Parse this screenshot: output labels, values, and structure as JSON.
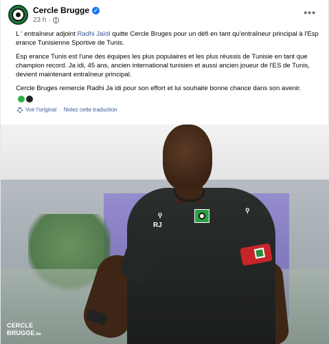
{
  "post": {
    "page_name": "Cercle Brugge",
    "time": "23 h",
    "more_label": "•••",
    "paragraphs": {
      "p1_before": "L ' entraîneur adjoint ",
      "p1_mention": "Radhi Jaïdi",
      "p1_after": " quitte Cercle Bruges pour un défi en tant qu'entraîneur principal à l'Esp erance Tunisienne Sportive de Tunis.",
      "p2": "Esp erance Tunis est l'une des équipes les plus populaires et les plus réussis de Tunisie en tant que champion record. Ja idi, 45 ans, ancien international tunisien et aussi ancien joueur de l'ES de Tunis, devient maintenant entraîneur principal.",
      "p3": "Cercle Bruges remercie Radhi Ja idi pour son effort et lui souhaite bonne chance dans son avenir."
    },
    "emojis": [
      "green-circle",
      "black-circle"
    ],
    "see_original": "Voir l'original",
    "separator": "·",
    "rate_translation": "Notez cette traduction"
  },
  "photo": {
    "jersey_initials": "RJ",
    "watermark_line1": "CERCLE",
    "watermark_line2": "BRUGGE",
    "watermark_suffix": ".be"
  },
  "colors": {
    "link": "#385898",
    "verified": "#1877f2",
    "club_green": "#2e9e45",
    "armband_red": "#c8252a"
  }
}
